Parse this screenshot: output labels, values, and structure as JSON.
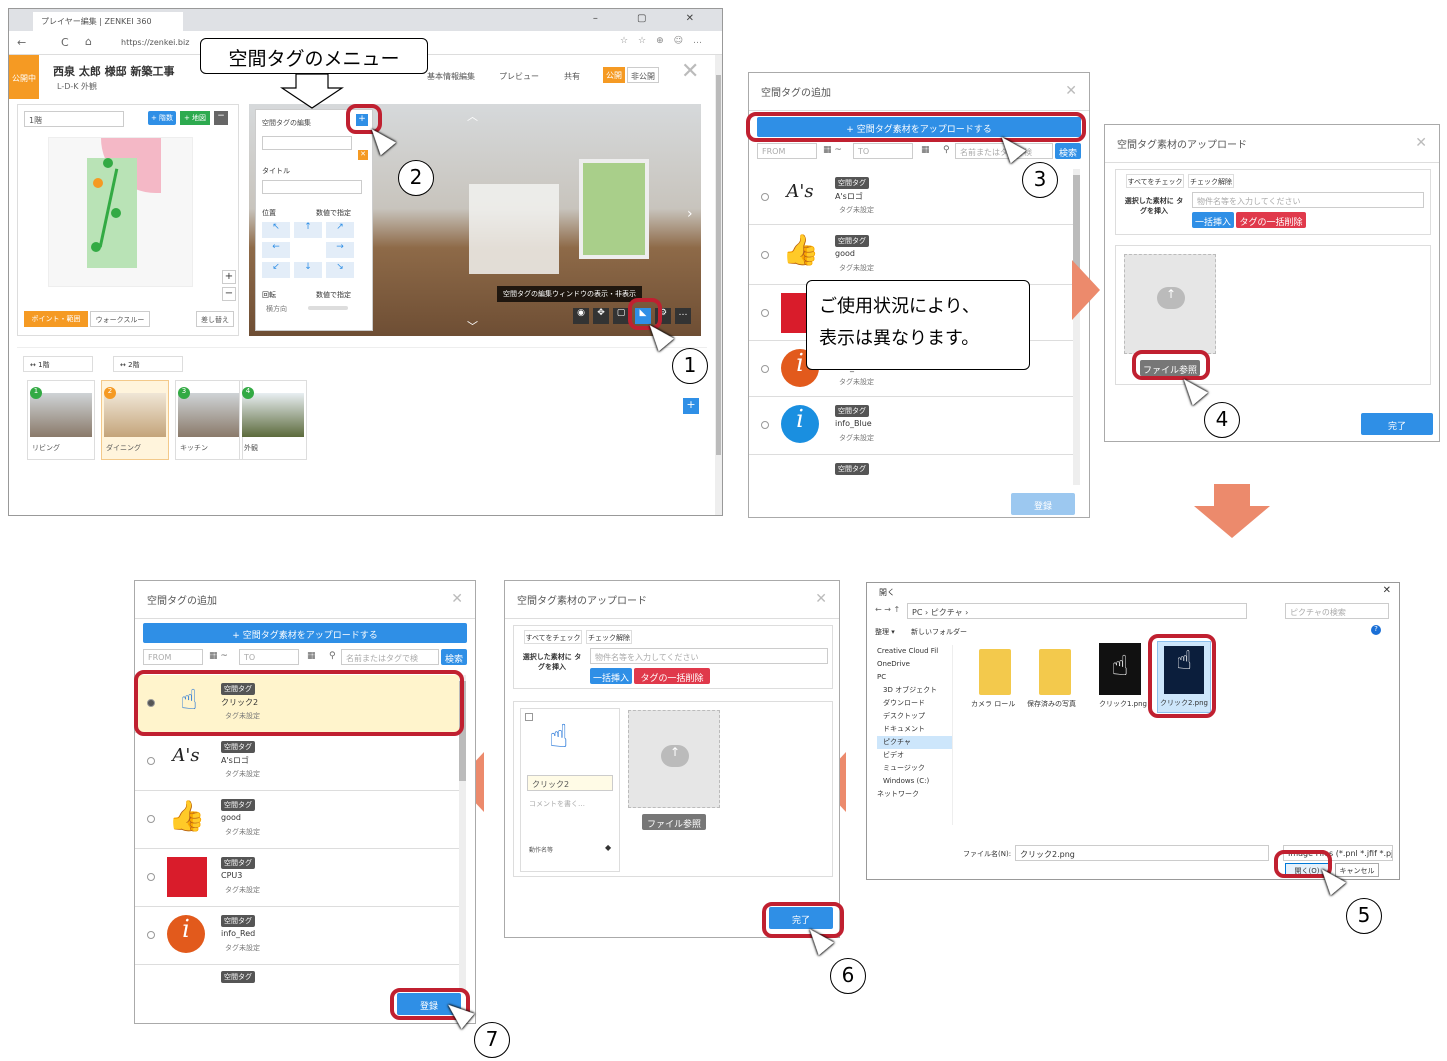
{
  "browser": {
    "tab": "プレイヤー編集 | ZENKEI 360",
    "url": "https://zenkei.biz"
  },
  "app": {
    "status": "公開中",
    "project": "西泉 太郎 様邸 新築工事",
    "scene": "L-D-K 外観",
    "nav": [
      "基本情報編集",
      "プレビュー",
      "共有"
    ],
    "publish": "公開",
    "unpublish": "非公開"
  },
  "floor": {
    "select": "1階",
    "add_floor": "+ 階数",
    "add_map": "+ 地図",
    "mode_point": "ポイント・範囲",
    "mode_walk": "ウォークスルー",
    "swap": "差し替え"
  },
  "spatial_editor": {
    "title": "空間タグの編集",
    "field_title": "タイトル",
    "position": "位置",
    "rotation": "回転",
    "numeric": "数値で指定",
    "horizontal": "横方向"
  },
  "callouts": {
    "menu": "空間タグのメニュー",
    "tooltip": "空間タグの編集ウィンドウの表示・非表示",
    "note_line1": "ご使用状況により、",
    "note_line2": "表示は異なります。"
  },
  "floor_tabs": [
    "1階",
    "2階"
  ],
  "scenes": [
    {
      "n": "1",
      "label": "リビング"
    },
    {
      "n": "2",
      "label": "ダイニング"
    },
    {
      "n": "3",
      "label": "キッチン"
    },
    {
      "n": "4",
      "label": "外観"
    }
  ],
  "add_dialog": {
    "title": "空間タグの追加",
    "upload_btn": "+ 空間タグ素材をアップロードする",
    "from": "FROM",
    "to": "TO",
    "search_ph": "名前またはタグで検",
    "search_btn": "検索",
    "register": "登録",
    "tag_label": "空間タグ",
    "unset": "タグ未設定",
    "items_a": [
      "A'sロゴ",
      "good",
      "CPU3",
      "info_Red",
      "info_Blue"
    ],
    "items_b": [
      "クリック2",
      "A'sロゴ",
      "good",
      "CPU3",
      "info_Red"
    ]
  },
  "upload_dialog": {
    "title": "空間タグ素材のアップロード",
    "check_all": "すべてをチェック",
    "uncheck": "チェック解除",
    "insert_label": "選択した素材に タグを挿入",
    "input_ph": "物件名等を入力してください",
    "batch_insert": "一括挿入",
    "batch_delete": "タグの一括削除",
    "file_browse": "ファイル参照",
    "done": "完了",
    "name_value": "クリック2",
    "comment_ph": "コメントを書く…",
    "action": "動作名等"
  },
  "file_dialog": {
    "title": "開く",
    "path": "PC › ピクチャ ›",
    "search": "ピクチャの検索",
    "organize": "整理 ▾",
    "new_folder": "新しいフォルダー",
    "tree": [
      "Creative Cloud Fil",
      "OneDrive",
      "PC",
      "3D オブジェクト",
      "ダウンロード",
      "デスクトップ",
      "ドキュメント",
      "ピクチャ",
      "ビデオ",
      "ミュージック",
      "Windows (C:)",
      "ネットワーク"
    ],
    "files": [
      "カメラ ロール",
      "保存済みの写真",
      "クリック1.png",
      "クリック2.png"
    ],
    "filename_label": "ファイル名(N):",
    "filename": "クリック2.png",
    "filter": "Image Files (*.pnl *.jfif *.pjpeg",
    "open": "開く(O)",
    "cancel": "キャンセル"
  },
  "steps": [
    "1",
    "2",
    "3",
    "4",
    "5",
    "6",
    "7"
  ]
}
